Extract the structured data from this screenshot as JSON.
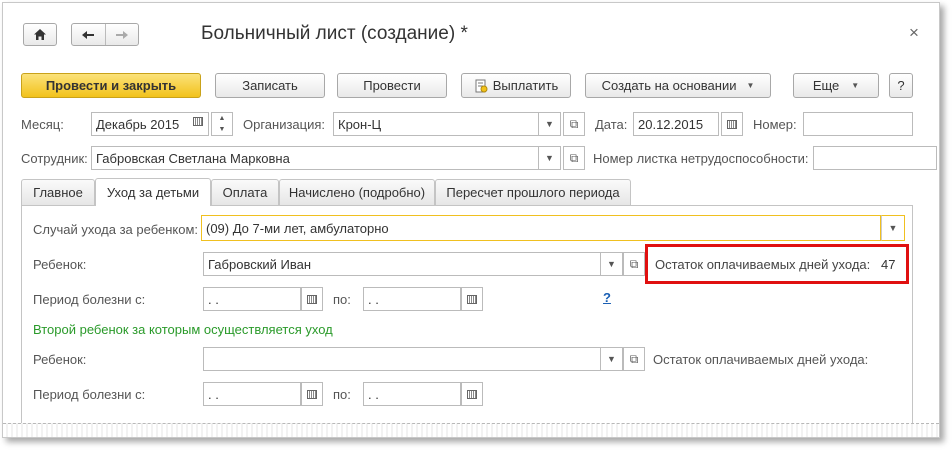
{
  "window": {
    "title": "Больничный лист (создание) *",
    "close_glyph": "×"
  },
  "toolbar": {
    "post_close": "Провести и закрыть",
    "save": "Записать",
    "post": "Провести",
    "pay": "Выплатить",
    "create_based": "Создать на основании",
    "more": "Еще",
    "help": "?"
  },
  "header": {
    "month_label": "Месяц:",
    "month_value": "Декабрь 2015",
    "org_label": "Организация:",
    "org_value": "Крон-Ц",
    "date_label": "Дата:",
    "date_value": "20.12.2015",
    "number_label": "Номер:",
    "number_value": "",
    "employee_label": "Сотрудник:",
    "employee_value": "Габровская Светлана Марковна",
    "sheet_number_label": "Номер листка нетрудоспособности:",
    "sheet_number_value": ""
  },
  "tabs": [
    {
      "label": "Главное"
    },
    {
      "label": "Уход за детьми"
    },
    {
      "label": "Оплата"
    },
    {
      "label": "Начислено (подробно)"
    },
    {
      "label": "Пересчет прошлого периода"
    }
  ],
  "care": {
    "case_label": "Случай ухода за ребенком:",
    "case_value": "(09) До 7-ми лет, амбулаторно",
    "child_label": "Ребенок:",
    "child_value": "Габровский Иван",
    "remaining_label": "Остаток оплачиваемых дней ухода:",
    "remaining_value": "47",
    "period_label": "Период болезни с:",
    "period_from": " .  .",
    "to_label": "по:",
    "period_to": " .  .",
    "help_link": "?",
    "second_child_header": "Второй ребенок за которым осуществляется уход",
    "child2_label": "Ребенок:",
    "child2_value": "",
    "remaining2_label": "Остаток оплачиваемых дней ухода:",
    "period2_label": "Период болезни с:",
    "period2_from": " .  .",
    "to2_label": "по:",
    "period2_to": " .  ."
  },
  "colors": {
    "primary_button": "#f2c21b",
    "highlight_box": "#e01010",
    "section_header": "#2a9a2a",
    "link": "#1a5fb4"
  }
}
